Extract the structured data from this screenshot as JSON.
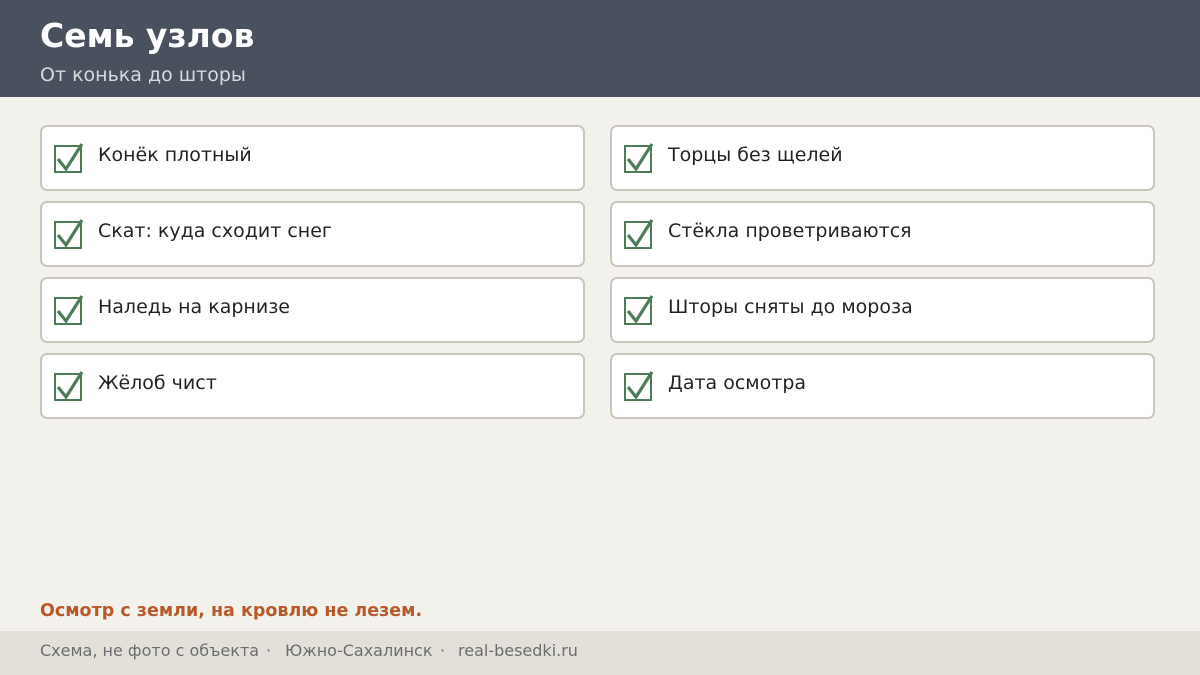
{
  "header": {
    "title": "Семь узлов",
    "subtitle": "От конька до шторы"
  },
  "checklist": [
    {
      "label": "Конёк плотный",
      "checked": true
    },
    {
      "label": "Скат: куда сходит снег",
      "checked": true
    },
    {
      "label": "Наледь на карнизе",
      "checked": true
    },
    {
      "label": "Жёлоб чист",
      "checked": true
    },
    {
      "label": "Торцы без щелей",
      "checked": true
    },
    {
      "label": "Стёкла проветриваются",
      "checked": true
    },
    {
      "label": "Шторы сняты до мороза",
      "checked": true
    },
    {
      "label": "Дата осмотра",
      "checked": true
    }
  ],
  "note": "Осмотр с земли, на кровлю не лезем.",
  "footer": {
    "caption": "Схема, не фото с объекта",
    "city": "Южно-Сахалинск",
    "site": "real-besedki.ru",
    "separator": "·"
  },
  "colors": {
    "header_bg": "#48515d",
    "page_bg": "#f3f1ec",
    "check_green": "#4e7c58",
    "note_accent": "#b75a2a",
    "footer_bg": "#e3e0da"
  },
  "icons": {
    "check": "checkmark-icon"
  }
}
